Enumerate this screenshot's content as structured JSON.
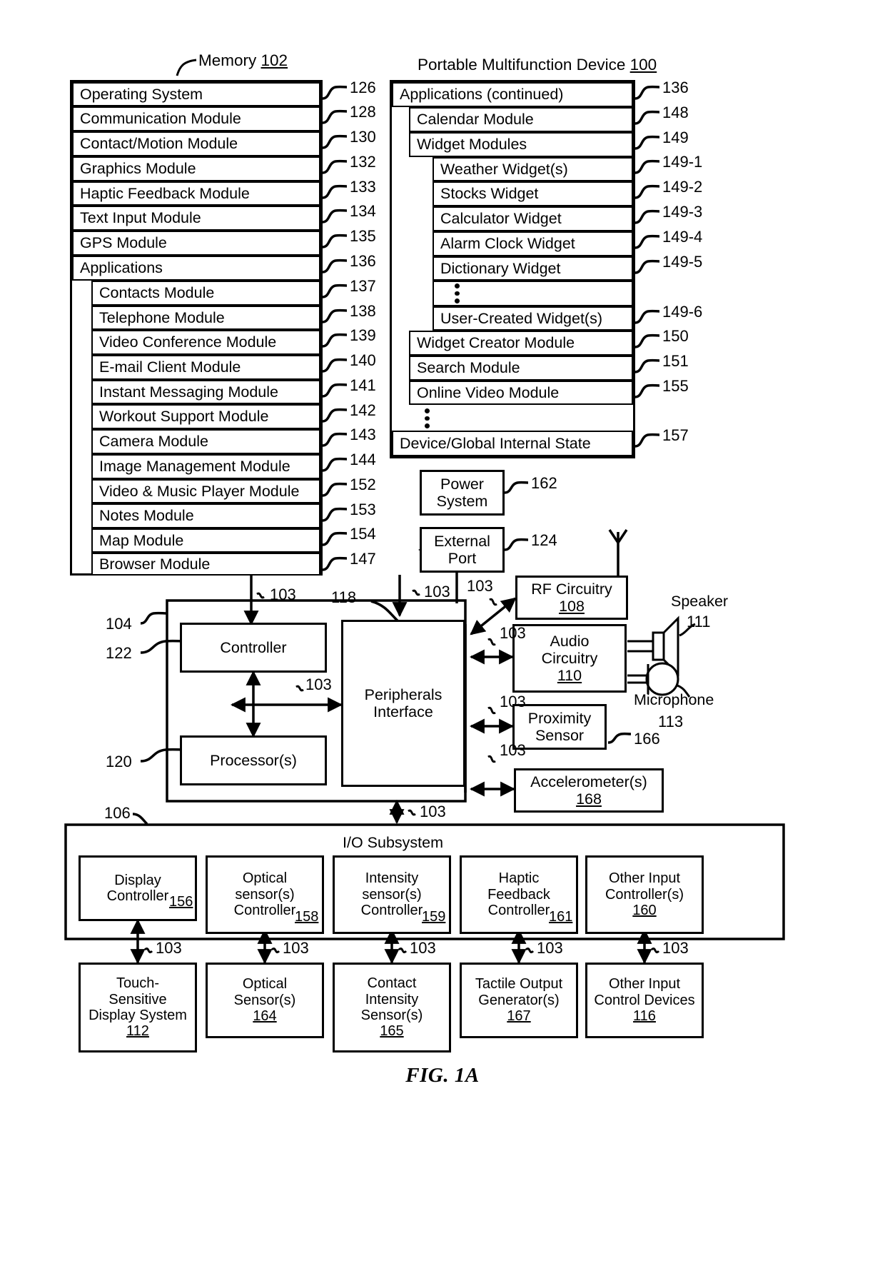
{
  "figure": {
    "caption": "FIG. 1A"
  },
  "memory": {
    "title": "Memory",
    "title_ref": "102",
    "rows": [
      {
        "label": "Operating System",
        "ref": "126"
      },
      {
        "label": "Communication Module",
        "ref": "128"
      },
      {
        "label": "Contact/Motion Module",
        "ref": "130"
      },
      {
        "label": "Graphics Module",
        "ref": "132"
      },
      {
        "label": "Haptic Feedback Module",
        "ref": "133"
      },
      {
        "label": "Text Input Module",
        "ref": "134"
      },
      {
        "label": "GPS Module",
        "ref": "135"
      },
      {
        "label": "Applications",
        "ref": "136"
      },
      {
        "label": "Contacts Module",
        "ref": "137"
      },
      {
        "label": "Telephone Module",
        "ref": "138"
      },
      {
        "label": "Video Conference Module",
        "ref": "139"
      },
      {
        "label": "E-mail Client Module",
        "ref": "140"
      },
      {
        "label": "Instant Messaging Module",
        "ref": "141"
      },
      {
        "label": "Workout Support Module",
        "ref": "142"
      },
      {
        "label": "Camera Module",
        "ref": "143"
      },
      {
        "label": "Image Management Module",
        "ref": "144"
      },
      {
        "label": "Video & Music Player Module",
        "ref": "152"
      },
      {
        "label": "Notes Module",
        "ref": "153"
      },
      {
        "label": "Map Module",
        "ref": "154"
      },
      {
        "label": "Browser Module",
        "ref": "147"
      }
    ]
  },
  "device": {
    "title": "Portable Multifunction Device",
    "title_ref": "100",
    "rows": [
      {
        "label": "Applications (continued)",
        "ref": "136"
      },
      {
        "label": "Calendar Module",
        "ref": "148"
      },
      {
        "label": "Widget Modules",
        "ref": "149"
      },
      {
        "label": "Weather Widget(s)",
        "ref": "149-1"
      },
      {
        "label": "Stocks Widget",
        "ref": "149-2"
      },
      {
        "label": "Calculator Widget",
        "ref": "149-3"
      },
      {
        "label": "Alarm Clock Widget",
        "ref": "149-4"
      },
      {
        "label": "Dictionary Widget",
        "ref": "149-5"
      },
      {
        "label": "User-Created Widget(s)",
        "ref": "149-6"
      },
      {
        "label": "Widget Creator Module",
        "ref": "150"
      },
      {
        "label": "Search Module",
        "ref": "151"
      },
      {
        "label": "Online Video Module",
        "ref": "155"
      },
      {
        "label": "Device/Global Internal State",
        "ref": "157"
      }
    ]
  },
  "blocks": {
    "power_system": {
      "label": "Power\nSystem",
      "ref": "162"
    },
    "external_port": {
      "label": "External\nPort",
      "ref": "124"
    },
    "rf_circuitry": {
      "label": "RF Circuitry",
      "ref": "108"
    },
    "audio_circuitry": {
      "label": "Audio\nCircuitry",
      "ref": "110"
    },
    "proximity_sensor": {
      "label": "Proximity\nSensor",
      "ref": "166"
    },
    "accelerometer": {
      "label": "Accelerometer(s)",
      "ref": "168"
    },
    "controller": {
      "label": "Controller",
      "ref": "122"
    },
    "processor": {
      "label": "Processor(s)",
      "ref": "120"
    },
    "peripherals_interface": {
      "label": "Peripherals\nInterface",
      "ref": "118"
    },
    "cpu_enclosure_ref": "104",
    "speaker": {
      "label": "Speaker",
      "ref": "111"
    },
    "microphone": {
      "label": "Microphone",
      "ref": "113"
    }
  },
  "io_subsystem": {
    "title": "I/O Subsystem",
    "ref": "106",
    "controllers": [
      {
        "label": "Display\nController",
        "ref": "156"
      },
      {
        "label": "Optical\nsensor(s)\nController",
        "ref": "158"
      },
      {
        "label": "Intensity\nsensor(s)\nController",
        "ref": "159"
      },
      {
        "label": "Haptic\nFeedback\nController",
        "ref": "161"
      },
      {
        "label": "Other Input\nController(s)",
        "ref": "160"
      }
    ],
    "devices": [
      {
        "label": "Touch-\nSensitive\nDisplay System",
        "ref": "112"
      },
      {
        "label": "Optical\nSensor(s)",
        "ref": "164"
      },
      {
        "label": "Contact\nIntensity\nSensor(s)",
        "ref": "165"
      },
      {
        "label": "Tactile Output\nGenerator(s)",
        "ref": "167"
      },
      {
        "label": "Other Input\nControl Devices",
        "ref": "116"
      }
    ],
    "bus_refs": [
      "103",
      "103",
      "103",
      "103",
      "103"
    ]
  },
  "bus_labels": {
    "memory_to_controller": "103",
    "controller_to_peripherals": "103",
    "port_to_peripherals": "103",
    "peripherals_to_rf": "103",
    "peripherals_to_audio": "103",
    "peripherals_to_proximity": "103",
    "peripherals_to_accel": "103",
    "peripherals_to_io": "103"
  }
}
